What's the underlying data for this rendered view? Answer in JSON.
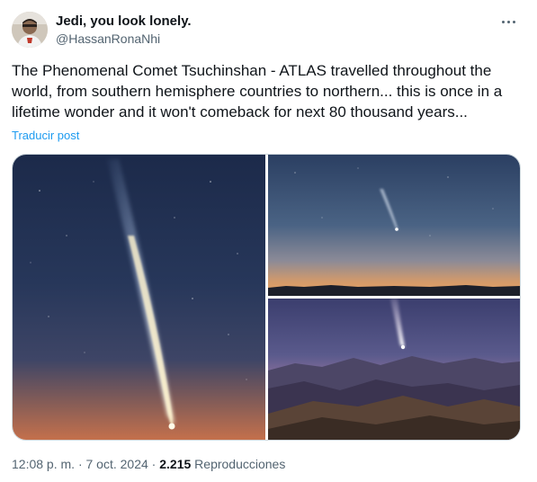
{
  "author": {
    "display_name": "Jedi, you look lonely.",
    "handle": "@HassanRonaNhi",
    "avatar_icon": "user-avatar"
  },
  "more_icon": "more-options-icon",
  "tweet": {
    "text": "The Phenomenal Comet Tsuchinshan - ATLAS travelled throughout the world, from southern hemisphere countries to northern... this is once in a lifetime wonder and it won't comeback for next 80 thousand years...",
    "translate_label": "Traducir post"
  },
  "media": {
    "images": [
      {
        "subject": "comet-tail-sky"
      },
      {
        "subject": "comet-over-horizon"
      },
      {
        "subject": "comet-over-mountains"
      }
    ]
  },
  "footer": {
    "time": "12:08 p. m.",
    "separator": "·",
    "date": "7 oct. 2024",
    "views_count": "2.215",
    "views_label": "Reproducciones"
  },
  "colors": {
    "link": "#1d9bf0",
    "text_primary": "#0f1419",
    "text_secondary": "#536471",
    "border": "#cfd9de"
  }
}
